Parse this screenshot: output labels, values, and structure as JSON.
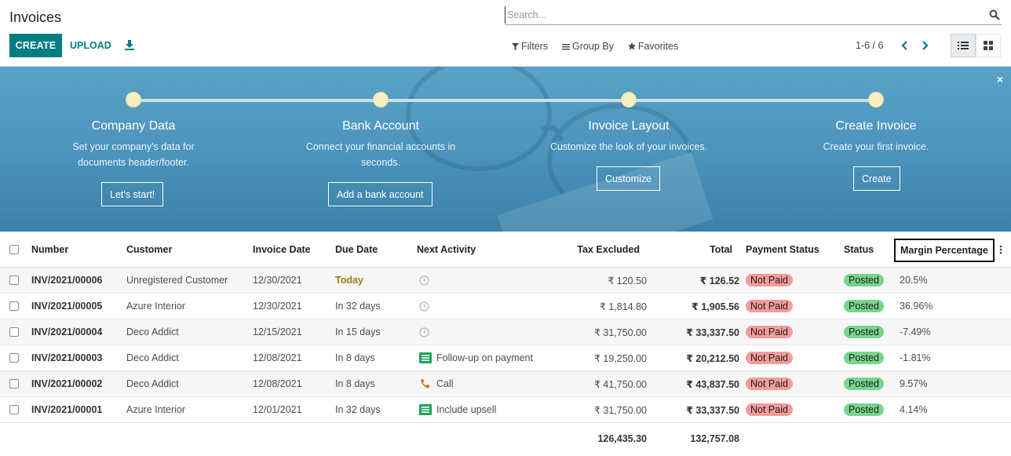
{
  "header": {
    "title": "Invoices",
    "create_label": "CREATE",
    "upload_label": "UPLOAD",
    "search_placeholder": "Search...",
    "filters_label": "Filters",
    "groupby_label": "Group By",
    "favorites_label": "Favorites",
    "pager": "1-6 / 6"
  },
  "banner": {
    "close": "×",
    "steps": [
      {
        "title": "Company Data",
        "desc1": "Set your company's data for",
        "desc2": "documents header/footer.",
        "button": "Let's start!"
      },
      {
        "title": "Bank Account",
        "desc1": "Connect your financial accounts in",
        "desc2": "seconds.",
        "button": "Add a bank account"
      },
      {
        "title": "Invoice Layout",
        "desc1": "Customize the look of your invoices.",
        "desc2": "",
        "button": "Customize"
      },
      {
        "title": "Create Invoice",
        "desc1": "Create your first invoice.",
        "desc2": "",
        "button": "Create"
      }
    ]
  },
  "table": {
    "columns": [
      "Number",
      "Customer",
      "Invoice Date",
      "Due Date",
      "Next Activity",
      "Tax Excluded",
      "Total",
      "Payment Status",
      "Status",
      "Margin Percentage"
    ],
    "rows": [
      {
        "number": "INV/2021/00006",
        "customer": "Unregistered Customer",
        "invoice_date": "12/30/2021",
        "due_date": "Today",
        "activity": "",
        "activity_icon": "clock-icon",
        "tax_excluded": "₹ 120.50",
        "total": "₹ 126.52",
        "payment_status": "Not Paid",
        "status": "Posted",
        "margin": "20.5%"
      },
      {
        "number": "INV/2021/00005",
        "customer": "Azure Interior",
        "invoice_date": "12/30/2021",
        "due_date": "In 32 days",
        "activity": "",
        "activity_icon": "clock-icon",
        "tax_excluded": "₹ 1,814.80",
        "total": "₹ 1,905.56",
        "payment_status": "Not Paid",
        "status": "Posted",
        "margin": "36.96%"
      },
      {
        "number": "INV/2021/00004",
        "customer": "Deco Addict",
        "invoice_date": "12/15/2021",
        "due_date": "In 15 days",
        "activity": "",
        "activity_icon": "clock-icon",
        "tax_excluded": "₹ 31,750.00",
        "total": "₹ 33,337.50",
        "payment_status": "Not Paid",
        "status": "Posted",
        "margin": "-7.49%"
      },
      {
        "number": "INV/2021/00003",
        "customer": "Deco Addict",
        "invoice_date": "12/08/2021",
        "due_date": "In 8 days",
        "activity": "Follow-up on payment",
        "activity_icon": "list-icon",
        "tax_excluded": "₹ 19,250.00",
        "total": "₹ 20,212.50",
        "payment_status": "Not Paid",
        "status": "Posted",
        "margin": "-1.81%"
      },
      {
        "number": "INV/2021/00002",
        "customer": "Deco Addict",
        "invoice_date": "12/08/2021",
        "due_date": "In 8 days",
        "activity": "Call",
        "activity_icon": "phone-icon",
        "tax_excluded": "₹ 41,750.00",
        "total": "₹ 43,837.50",
        "payment_status": "Not Paid",
        "status": "Posted",
        "margin": "9.57%"
      },
      {
        "number": "INV/2021/00001",
        "customer": "Azure Interior",
        "invoice_date": "12/01/2021",
        "due_date": "In 32 days",
        "activity": "Include upsell",
        "activity_icon": "list-icon",
        "tax_excluded": "₹ 31,750.00",
        "total": "₹ 33,337.50",
        "payment_status": "Not Paid",
        "status": "Posted",
        "margin": "4.14%"
      }
    ],
    "totals": {
      "tax_excluded": "126,435.30",
      "total": "132,757.08"
    }
  },
  "colors": {
    "primary": "#017e84",
    "not_paid": "#f49b9b",
    "posted": "#77d58c",
    "today": "#a07815",
    "banner": "#4b93bb"
  }
}
